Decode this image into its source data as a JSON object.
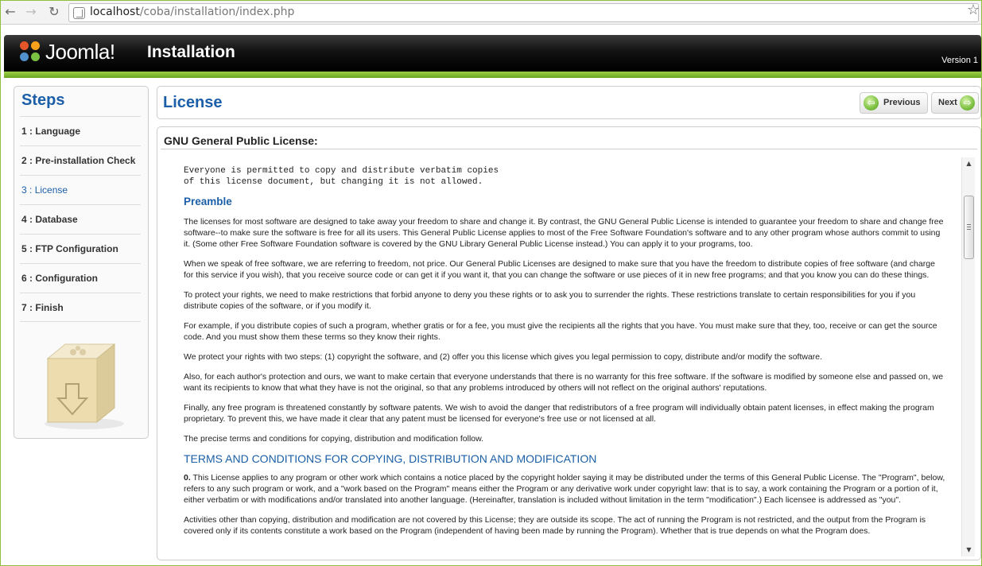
{
  "browser": {
    "url_host": "localhost",
    "url_path": "/coba/installation/index.php"
  },
  "header": {
    "logo_text": "Joomla!",
    "title": "Installation",
    "version": "Version 1"
  },
  "sidebar": {
    "title": "Steps",
    "steps": [
      {
        "num": "1 :",
        "label": "Language"
      },
      {
        "num": "2 :",
        "label": "Pre-installation Check"
      },
      {
        "num": "3 :",
        "label": "License"
      },
      {
        "num": "4 :",
        "label": "Database"
      },
      {
        "num": "5 :",
        "label": "FTP Configuration"
      },
      {
        "num": "6 :",
        "label": "Configuration"
      },
      {
        "num": "7 :",
        "label": "Finish"
      }
    ]
  },
  "license_panel": {
    "title": "License",
    "prev_label": "Previous",
    "next_label": "Next"
  },
  "content": {
    "title": "GNU General Public License:",
    "mono_line1": "Everyone is permitted to copy and distribute verbatim copies",
    "mono_line2": "of this license document, but changing it is not allowed.",
    "preamble_heading": "Preamble",
    "p1": "The licenses for most software are designed to take away your freedom to share and change it. By contrast, the GNU General Public License is intended to guarantee your freedom to share and change free software--to make sure the software is free for all its users. This General Public License applies to most of the Free Software Foundation's software and to any other program whose authors commit to using it. (Some other Free Software Foundation software is covered by the GNU Library General Public License instead.) You can apply it to your programs, too.",
    "p2": "When we speak of free software, we are referring to freedom, not price. Our General Public Licenses are designed to make sure that you have the freedom to distribute copies of free software (and charge for this service if you wish), that you receive source code or can get it if you want it, that you can change the software or use pieces of it in new free programs; and that you know you can do these things.",
    "p3": "To protect your rights, we need to make restrictions that forbid anyone to deny you these rights or to ask you to surrender the rights. These restrictions translate to certain responsibilities for you if you distribute copies of the software, or if you modify it.",
    "p4": "For example, if you distribute copies of such a program, whether gratis or for a fee, you must give the recipients all the rights that you have. You must make sure that they, too, receive or can get the source code. And you must show them these terms so they know their rights.",
    "p5": "We protect your rights with two steps: (1) copyright the software, and (2) offer you this license which gives you legal permission to copy, distribute and/or modify the software.",
    "p6": "Also, for each author's protection and ours, we want to make certain that everyone understands that there is no warranty for this free software. If the software is modified by someone else and passed on, we want its recipients to know that what they have is not the original, so that any problems introduced by others will not reflect on the original authors' reputations.",
    "p7": "Finally, any free program is threatened constantly by software patents. We wish to avoid the danger that redistributors of a free program will individually obtain patent licenses, in effect making the program proprietary. To prevent this, we have made it clear that any patent must be licensed for everyone's free use or not licensed at all.",
    "p8": "The precise terms and conditions for copying, distribution and modification follow.",
    "terms_heading": "TERMS AND CONDITIONS FOR COPYING, DISTRIBUTION AND MODIFICATION",
    "t0_num": "0.",
    "t0": " This License applies to any program or other work which contains a notice placed by the copyright holder saying it may be distributed under the terms of this General Public License. The \"Program\", below, refers to any such program or work, and a \"work based on the Program\" means either the Program or any derivative work under copyright law: that is to say, a work containing the Program or a portion of it, either verbatim or with modifications and/or translated into another language. (Hereinafter, translation is included without limitation in the term \"modification\".) Each licensee is addressed as \"you\".",
    "t1": "Activities other than copying, distribution and modification are not covered by this License; they are outside its scope. The act of running the Program is not restricted, and the output from the Program is covered only if its contents constitute a work based on the Program (independent of having been made by running the Program). Whether that is true depends on what the Program does."
  },
  "colors": {
    "accent_blue": "#1b5fa8",
    "accent_green": "#7dc142"
  }
}
